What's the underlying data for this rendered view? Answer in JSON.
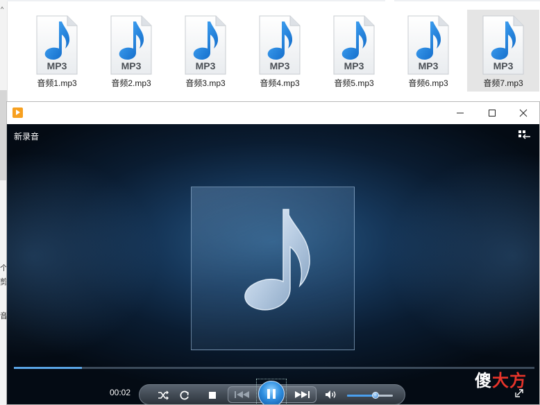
{
  "explorer": {
    "files": [
      {
        "name": "音频1.mp3",
        "icon_text": "MP3",
        "selected": false
      },
      {
        "name": "音频2.mp3",
        "icon_text": "MP3",
        "selected": false
      },
      {
        "name": "音频3.mp3",
        "icon_text": "MP3",
        "selected": false
      },
      {
        "name": "音频4.mp3",
        "icon_text": "MP3",
        "selected": false
      },
      {
        "name": "音频5.mp3",
        "icon_text": "MP3",
        "selected": false
      },
      {
        "name": "音频6.mp3",
        "icon_text": "MP3",
        "selected": false
      },
      {
        "name": "音频7.mp3",
        "icon_text": "MP3",
        "selected": true
      }
    ],
    "left_fragments": [
      "个",
      "剪",
      "音"
    ]
  },
  "player": {
    "title": "新录音",
    "current_time": "00:02",
    "progress_fraction": 0.13,
    "volume_fraction": 0.62,
    "icons": {
      "app": "media-player-icon",
      "minimize": "minimize-icon",
      "maximize": "maximize-icon",
      "close": "close-icon",
      "switch": "switch-to-library-icon",
      "shuffle": "shuffle-icon",
      "repeat": "repeat-icon",
      "stop": "stop-icon",
      "previous": "previous-icon",
      "pause": "pause-icon",
      "next": "next-icon",
      "mute": "speaker-icon",
      "fullscreen": "fullscreen-icon"
    },
    "colors": {
      "accent": "#2f8fe0",
      "seek_fill": "#5aa5e6",
      "file_icon_note": "#1e88e5"
    }
  },
  "watermark": {
    "text_part1": "傻",
    "text_part2": "大方"
  }
}
